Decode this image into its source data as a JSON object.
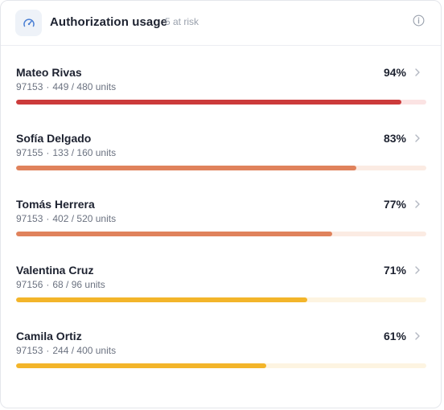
{
  "header": {
    "title": "Authorization usage",
    "subtitle": "5 at risk",
    "icon": "speedometer-icon",
    "info_icon": "info-icon"
  },
  "rows": [
    {
      "name": "Mateo Rivas",
      "code": "97153",
      "separator": "·",
      "units": "449 / 480 units",
      "percent_label": "94%",
      "percent": 94,
      "color": "#cc3b3b",
      "track_color": "#fbe3e3"
    },
    {
      "name": "Sofía Delgado",
      "code": "97155",
      "separator": "·",
      "units": "133 / 160 units",
      "percent_label": "83%",
      "percent": 83,
      "color": "#e0825c",
      "track_color": "#fbebe3"
    },
    {
      "name": "Tomás Herrera",
      "code": "97153",
      "separator": "·",
      "units": "402 / 520 units",
      "percent_label": "77%",
      "percent": 77,
      "color": "#e0825c",
      "track_color": "#fbebe3"
    },
    {
      "name": "Valentina Cruz",
      "code": "97156",
      "separator": "·",
      "units": "68 / 96 units",
      "percent_label": "71%",
      "percent": 71,
      "color": "#f3b52a",
      "track_color": "#fdf4e1"
    },
    {
      "name": "Camila Ortiz",
      "code": "97153",
      "separator": "·",
      "units": "244 / 400 units",
      "percent_label": "61%",
      "percent": 61,
      "color": "#f3b52a",
      "track_color": "#fdf4e1"
    }
  ]
}
